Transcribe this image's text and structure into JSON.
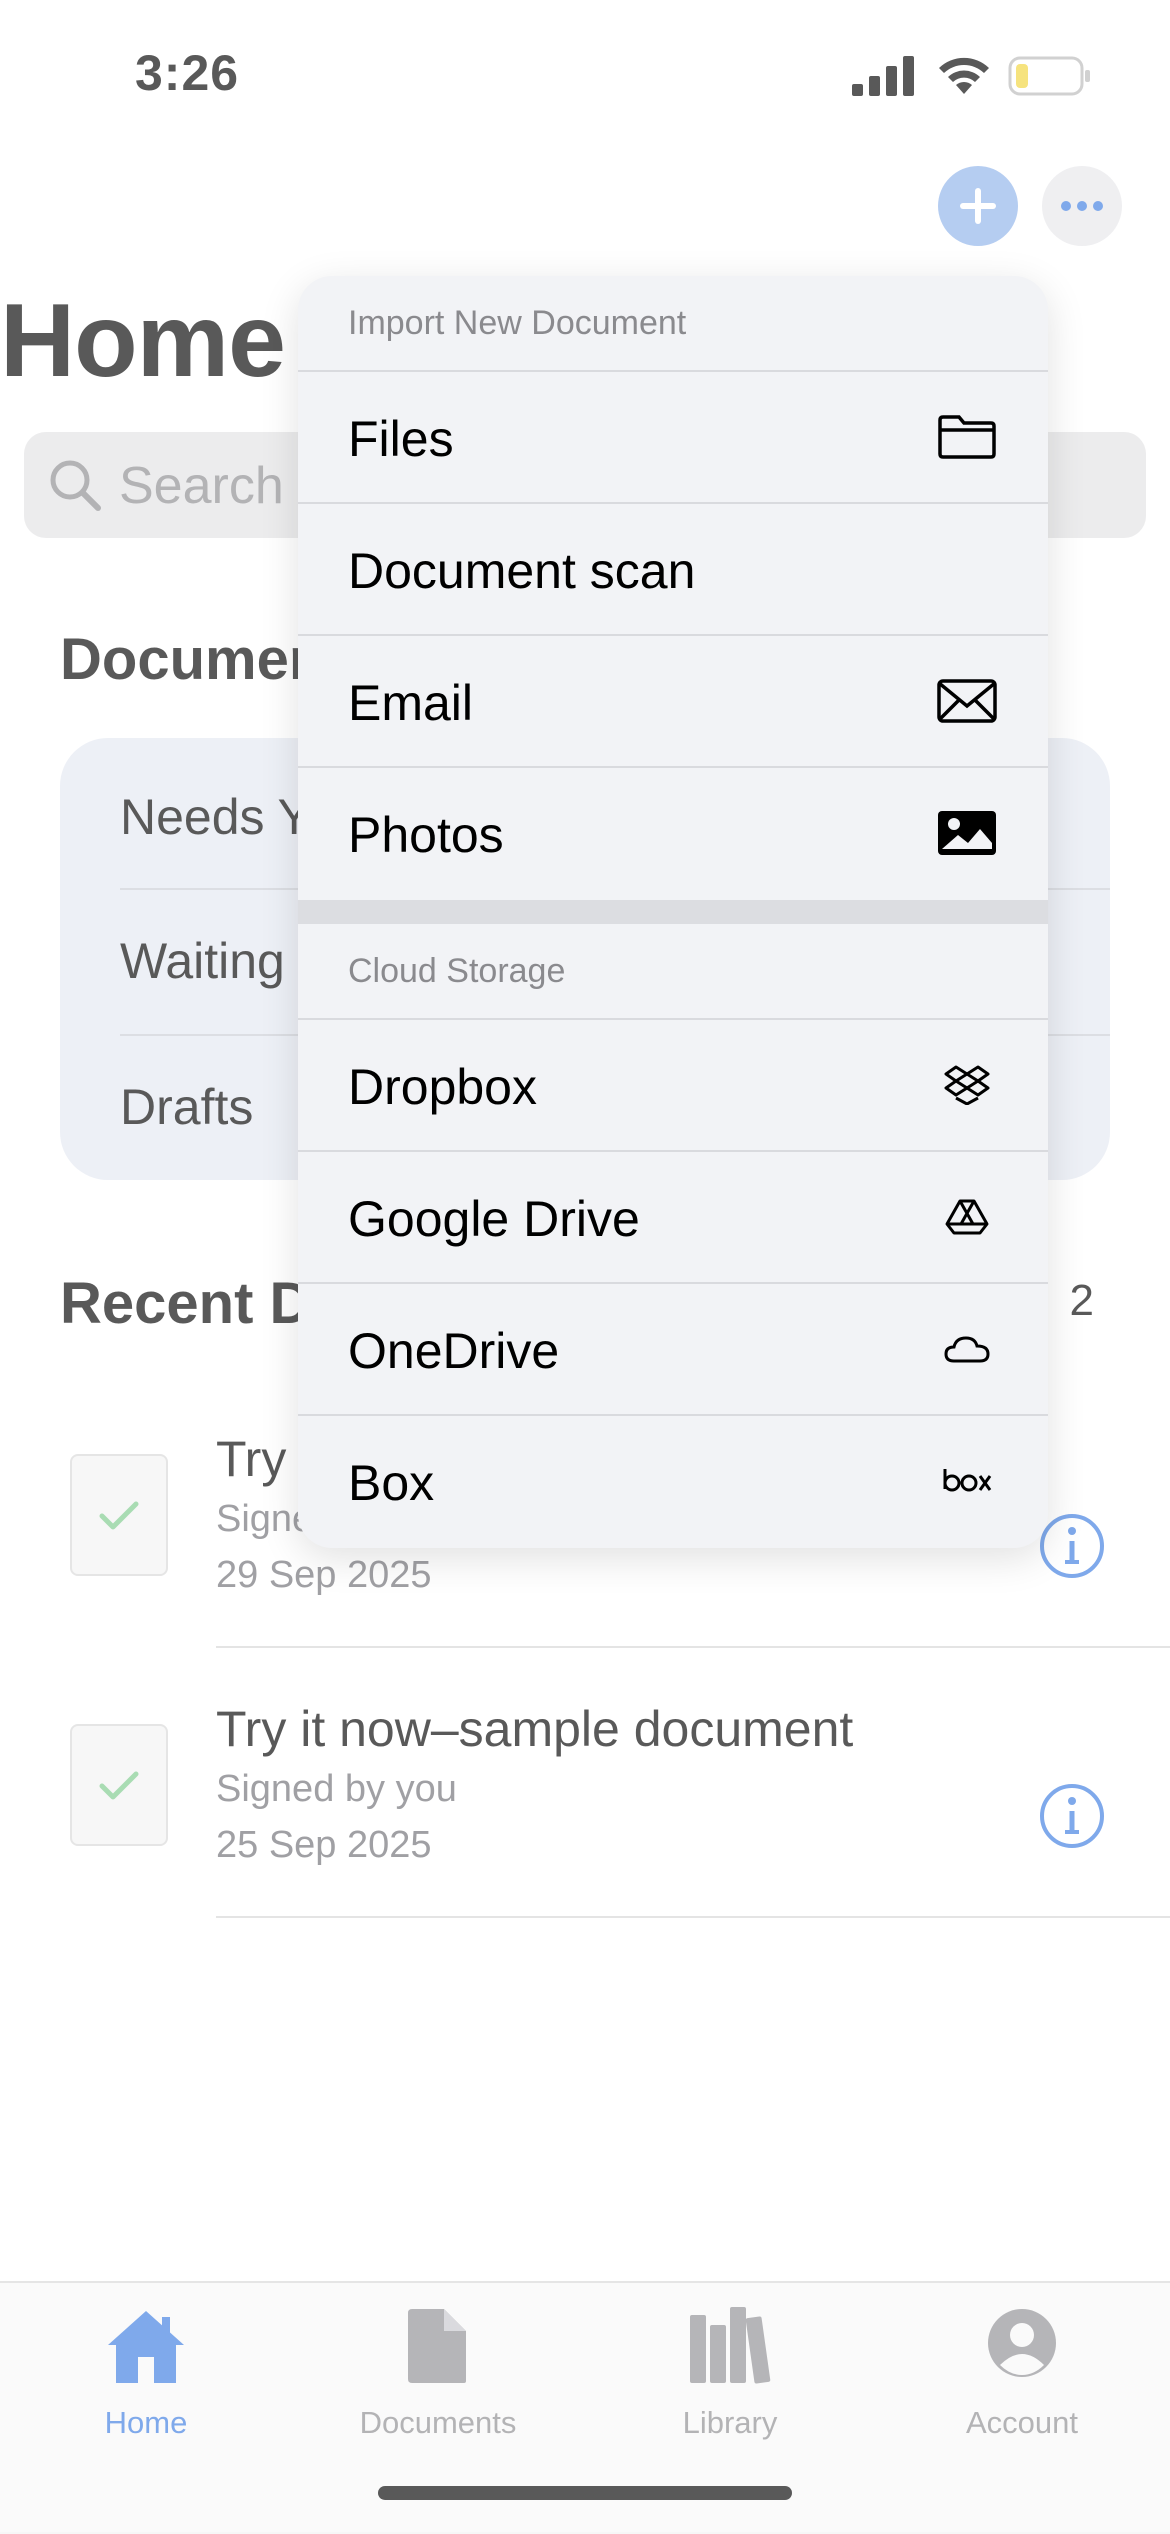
{
  "status_bar": {
    "time": "3:26"
  },
  "page": {
    "title": "Home",
    "search_placeholder": "Search",
    "documents_section_title": "Documen",
    "document_cards": [
      "Needs Y",
      "Waiting",
      "Drafts"
    ],
    "recent_section_title": "Recent D",
    "recent_count": "2",
    "recent_docs": [
      {
        "title": "Try",
        "subtitle": "Signe",
        "date": "29 Sep 2025"
      },
      {
        "title": "Try it now–sample document",
        "subtitle": "Signed by you",
        "date": "25 Sep 2025"
      }
    ]
  },
  "menu": {
    "import_header": "Import New Document",
    "import_items": [
      {
        "label": "Files",
        "icon": "folder-icon"
      },
      {
        "label": "Document scan",
        "icon": ""
      },
      {
        "label": "Email",
        "icon": "envelope-icon"
      },
      {
        "label": "Photos",
        "icon": "photo-icon"
      }
    ],
    "cloud_header": "Cloud Storage",
    "cloud_items": [
      {
        "label": "Dropbox",
        "icon": "dropbox-icon"
      },
      {
        "label": "Google Drive",
        "icon": "google-drive-icon"
      },
      {
        "label": "OneDrive",
        "icon": "cloud-icon"
      },
      {
        "label": "Box",
        "icon": "box-logo-icon"
      }
    ]
  },
  "tab_bar": {
    "tabs": [
      {
        "label": "Home",
        "active": true
      },
      {
        "label": "Documents",
        "active": false
      },
      {
        "label": "Library",
        "active": false
      },
      {
        "label": "Account",
        "active": false
      }
    ]
  },
  "colors": {
    "accent": "#3b7be0",
    "plus_button": "#8eb3ea",
    "check": "#7cc98a"
  }
}
